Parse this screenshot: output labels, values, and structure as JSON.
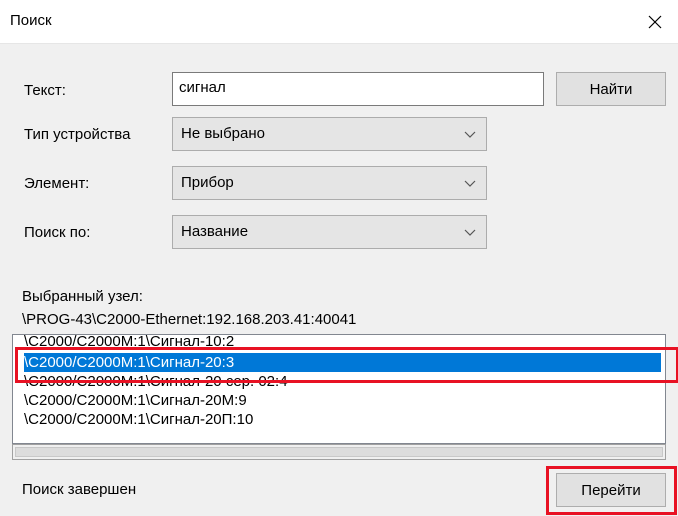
{
  "window": {
    "title": "Поиск",
    "close_icon": "close-icon"
  },
  "form": {
    "text_label": "Текст:",
    "text_value": "сигнал",
    "find_button": "Найти",
    "device_type_label": "Тип устройства",
    "device_type_value": "Не выбрано",
    "element_label": "Элемент:",
    "element_value": "Прибор",
    "search_by_label": "Поиск по:",
    "search_by_value": "Название"
  },
  "selected_node": {
    "label": "Выбранный узел:",
    "path": "\\PROG-43\\C2000-Ethernet:192.168.203.41:40041"
  },
  "results": [
    {
      "text": "\\C2000/C2000M:1\\Сигнал-10:2",
      "selected": false
    },
    {
      "text": "\\C2000/C2000M:1\\Сигнал-20:3",
      "selected": true
    },
    {
      "text": "\\C2000/C2000M:1\\Сигнал-20 сер. 02:4",
      "selected": false
    },
    {
      "text": "\\C2000/C2000M:1\\Сигнал-20М:9",
      "selected": false
    },
    {
      "text": "\\C2000/C2000M:1\\Сигнал-20П:10",
      "selected": false
    }
  ],
  "status": {
    "text": "Поиск завершен"
  },
  "goto_button": "Перейти",
  "colors": {
    "selection": "#0078d7",
    "highlight": "#e81123"
  }
}
